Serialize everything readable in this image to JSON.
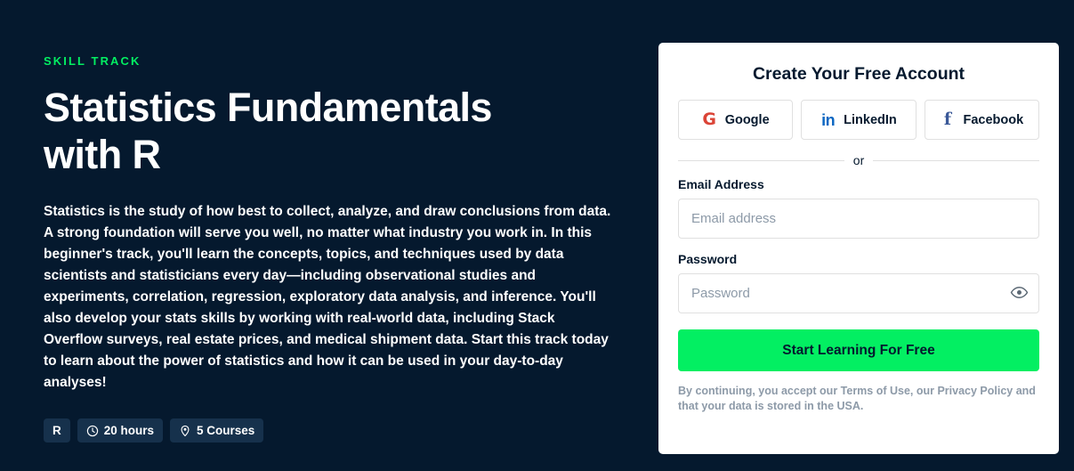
{
  "hero": {
    "eyebrow": "SKILL TRACK",
    "title": "Statistics Fundamentals with R",
    "description": "Statistics is the study of how best to collect, analyze, and draw conclusions from data. A strong foundation will serve you well, no matter what industry you work in. In this beginner's track, you'll learn the concepts, topics, and techniques used by data scientists and statisticians every day—including observational studies and experiments, correlation, regression, exploratory data analysis, and inference. You'll also develop your stats skills by working with real-world data, including Stack Overflow surveys, real estate prices, and medical shipment data. Start this track today to learn about the power of statistics and how it can be used in your day-to-day analyses!",
    "badges": [
      {
        "label": "R",
        "icon": ""
      },
      {
        "label": "20 hours",
        "icon": "clock-icon"
      },
      {
        "label": "5 Courses",
        "icon": "location-pin-icon"
      }
    ]
  },
  "signup": {
    "title": "Create Your Free Account",
    "social_buttons": [
      {
        "label": "Google",
        "icon": "google-icon",
        "glyph": "G"
      },
      {
        "label": "LinkedIn",
        "icon": "linkedin-icon",
        "glyph": "in"
      },
      {
        "label": "Facebook",
        "icon": "facebook-icon",
        "glyph": "f"
      }
    ],
    "divider_text": "or",
    "email_label": "Email Address",
    "email_placeholder": "Email address",
    "email_value": "",
    "password_label": "Password",
    "password_placeholder": "Password",
    "password_value": "",
    "password_toggle_icon": "eye-icon",
    "cta_label": "Start Learning For Free",
    "legal_text": "By continuing, you accept our Terms of Use, our Privacy Policy and that your data is stored in the USA."
  },
  "colors": {
    "background": "#05192e",
    "accent_green": "#03ef62",
    "badge_background": "#16314c",
    "card_background": "#ffffff",
    "muted_text": "#8d9aa8",
    "google_red": "#db4437",
    "linkedin_blue": "#0a66c2",
    "facebook_blue": "#3b5998"
  }
}
